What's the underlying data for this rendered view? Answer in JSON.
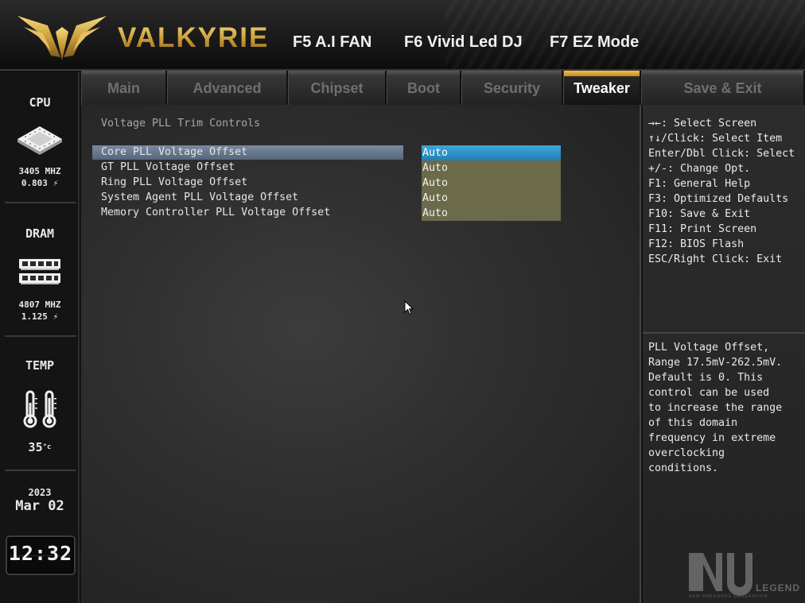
{
  "header": {
    "brand": "VALKYRIE",
    "hotkeys": [
      "F5 A.I FAN",
      "F6 Vivid Led DJ",
      "F7 EZ Mode"
    ]
  },
  "sidebar": {
    "cpu": {
      "title": "CPU",
      "freq": "3405 MHZ",
      "volt": "0.803",
      "icon": "cpu-chip-icon"
    },
    "dram": {
      "title": "DRAM",
      "freq": "4807 MHZ",
      "volt": "1.125",
      "icon": "memory-module-icon"
    },
    "temp": {
      "title": "TEMP",
      "value": "35",
      "unit": "°c",
      "icon": "thermometer-icon"
    },
    "date": {
      "year": "2023",
      "monthday": "Mar 02"
    },
    "time": "12:32"
  },
  "tabs": [
    {
      "label": "Main",
      "active": false
    },
    {
      "label": "Advanced",
      "active": false
    },
    {
      "label": "Chipset",
      "active": false
    },
    {
      "label": "Boot",
      "active": false
    },
    {
      "label": "Security",
      "active": false
    },
    {
      "label": "Tweaker",
      "active": true
    },
    {
      "label": "Save & Exit",
      "active": false
    }
  ],
  "main": {
    "section_title": "Voltage PLL Trim Controls",
    "options": [
      {
        "label": "Core PLL Voltage Offset",
        "value": "Auto",
        "selected": true
      },
      {
        "label": "GT PLL Voltage Offset",
        "value": "Auto",
        "selected": false
      },
      {
        "label": "Ring PLL Voltage Offset",
        "value": "Auto",
        "selected": false
      },
      {
        "label": "System Agent PLL Voltage Offset",
        "value": "Auto",
        "selected": false
      },
      {
        "label": "Memory Controller PLL Voltage Offset",
        "value": "Auto",
        "selected": false
      }
    ]
  },
  "help": {
    "keys": [
      "→←: Select Screen",
      "↑↓/Click: Select Item",
      "Enter/Dbl Click: Select",
      "+/-: Change Opt.",
      "F1: General Help",
      "F3: Optimized Defaults",
      "F10: Save & Exit",
      "F11: Print Screen",
      "F12: BIOS Flash",
      "ESC/Right Click: Exit"
    ],
    "description": [
      "PLL Voltage Offset,",
      "Range 17.5mV-262.5mV.",
      "Default is 0. This",
      "control can be used",
      "to increase the range",
      "of this domain",
      "frequency in extreme",
      "overclocking",
      "conditions."
    ]
  },
  "watermark": {
    "mark": "NU",
    "word": "LEGEND",
    "tagline": "NEW HARDWARE GENERATION"
  },
  "colors": {
    "accent_gold": "#d8ae4a",
    "selected_value": "#2b93c9",
    "value_box": "#6b6a4a",
    "highlight_row": "#66768c"
  }
}
